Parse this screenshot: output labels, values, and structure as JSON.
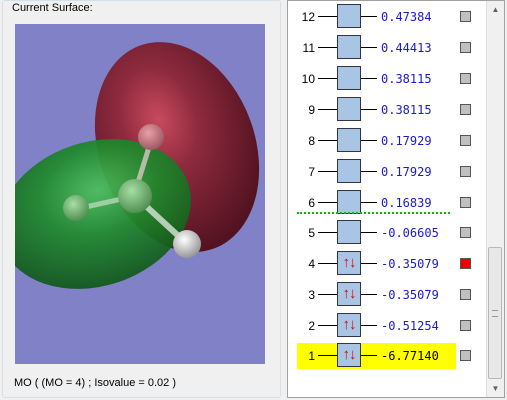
{
  "surface_panel": {
    "title": "Current Surface:",
    "status": "MO ( (MO = 4) ; Isovalue = 0.02 )",
    "colors": {
      "background": "#8181c8",
      "positive_lobe": "#7a2233",
      "negative_lobe": "#1f8a2c"
    }
  },
  "mo_list": {
    "orbitals": [
      {
        "number": "12",
        "energy": "0.47384",
        "occupied": false,
        "selected": false,
        "highlight": false
      },
      {
        "number": "11",
        "energy": "0.44413",
        "occupied": false,
        "selected": false,
        "highlight": false
      },
      {
        "number": "10",
        "energy": "0.38115",
        "occupied": false,
        "selected": false,
        "highlight": false
      },
      {
        "number": "9",
        "energy": "0.38115",
        "occupied": false,
        "selected": false,
        "highlight": false
      },
      {
        "number": "8",
        "energy": "0.17929",
        "occupied": false,
        "selected": false,
        "highlight": false
      },
      {
        "number": "7",
        "energy": "0.17929",
        "occupied": false,
        "selected": false,
        "highlight": false
      },
      {
        "number": "6",
        "energy": "0.16839",
        "occupied": false,
        "selected": false,
        "highlight": false
      },
      {
        "number": "5",
        "energy": "-0.06605",
        "occupied": false,
        "selected": false,
        "highlight": false
      },
      {
        "number": "4",
        "energy": "-0.35079",
        "occupied": true,
        "selected": true,
        "highlight": false
      },
      {
        "number": "3",
        "energy": "-0.35079",
        "occupied": true,
        "selected": false,
        "highlight": false
      },
      {
        "number": "2",
        "energy": "-0.51254",
        "occupied": true,
        "selected": false,
        "highlight": false
      },
      {
        "number": "1",
        "energy": "-6.77140",
        "occupied": true,
        "selected": false,
        "highlight": true
      }
    ],
    "occupied_arrows": "↑↓",
    "colors": {
      "energy": "#1a1acc",
      "highlight": "#ffff00",
      "selected": "#ee0000",
      "separator": "#00c000"
    }
  }
}
